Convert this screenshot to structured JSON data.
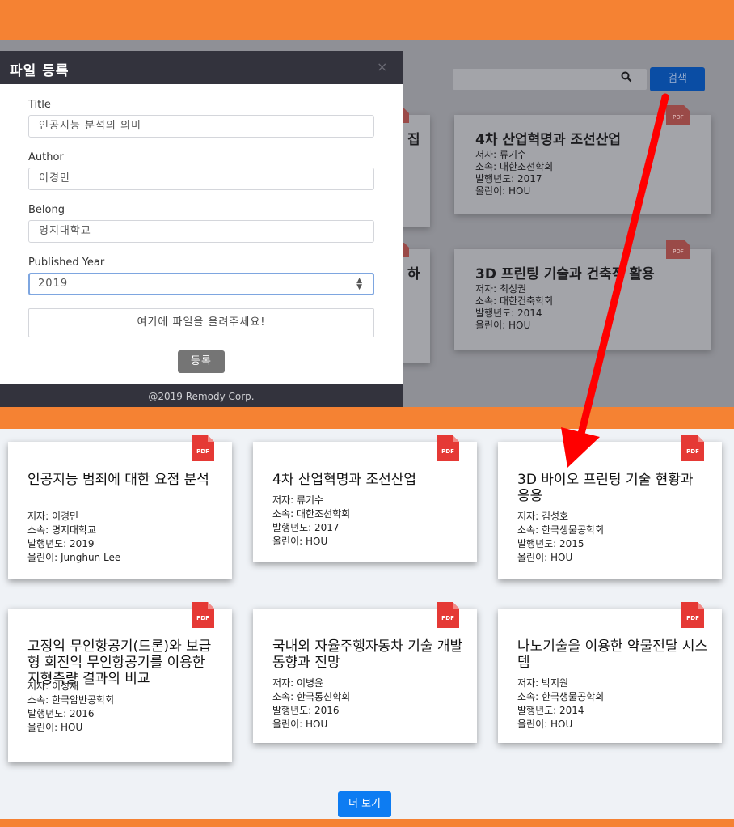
{
  "search": {
    "button_label": "검색"
  },
  "modal": {
    "title": "파일 등록",
    "close_glyph": "×",
    "fields": {
      "title": {
        "label": "Title",
        "value": "인공지능 분석의 의미"
      },
      "author": {
        "label": "Author",
        "value": "이경민"
      },
      "belong": {
        "label": "Belong",
        "value": "명지대학교"
      },
      "year": {
        "label": "Published Year",
        "value": "2019"
      }
    },
    "upload_text": "여기에 파일을 올려주세요!",
    "register_label": "등록",
    "footer": "@2019 Remody Corp."
  },
  "background_cards": [
    {
      "title": "4차 산업혁명과 조선산업",
      "author": "저자: 류기수",
      "belong": "소속: 대한조선학회",
      "year": "발행년도: 2017",
      "uploader": "올린이: HOU"
    },
    {
      "title": "3D 프린팅 기술과 건축적 활용",
      "author": "저자: 최성권",
      "belong": "소속: 대한건축학회",
      "year": "발행년도: 2014",
      "uploader": "올린이: HOU"
    }
  ],
  "background_partial": [
    "집",
    "하"
  ],
  "pdf_label": "PDF",
  "cards": [
    {
      "title": "인공지능 범죄에 대한 요점 분석",
      "author": "저자: 이경민",
      "belong": "소속: 명지대학교",
      "year": "발행년도: 2019",
      "uploader": "올린이: Junghun Lee"
    },
    {
      "title": "4차 산업혁명과 조선산업",
      "author": "저자: 류기수",
      "belong": "소속: 대한조선학회",
      "year": "발행년도: 2017",
      "uploader": "올린이: HOU"
    },
    {
      "title": "3D 바이오 프린팅 기술 현황과 응용",
      "author": "저자: 김성호",
      "belong": "소속: 한국생물공학회",
      "year": "발행년도: 2015",
      "uploader": "올린이: HOU"
    },
    {
      "title": "고정익 무인항공기(드론)와 보급형 회전익 무인항공기를 이용한 지형측량 결과의 비교",
      "author": "저자: 이성재",
      "belong": "소속: 한국암반공학회",
      "year": "발행년도: 2016",
      "uploader": "올린이: HOU"
    },
    {
      "title": "국내외 자율주행자동차 기술 개발 동향과 전망",
      "author": "저자: 이병윤",
      "belong": "소속: 한국통신학회",
      "year": "발행년도: 2016",
      "uploader": "올린이: HOU"
    },
    {
      "title": "나노기술을 이용한 약물전달 시스템",
      "author": "저자: 박지원",
      "belong": "소속: 한국생물공학회",
      "year": "발행년도: 2014",
      "uploader": "올린이: HOU"
    }
  ],
  "more_label": "더 보기",
  "colors": {
    "frame": "#f58233",
    "modal_header": "#33333d",
    "search_button": "#0a4da4",
    "more_button": "#0d7cf2",
    "pdf_icon": "#e53935",
    "arrow": "#ff0000"
  },
  "icons": [
    "search-icon",
    "close-icon",
    "pdf-icon",
    "spinner-icon"
  ]
}
